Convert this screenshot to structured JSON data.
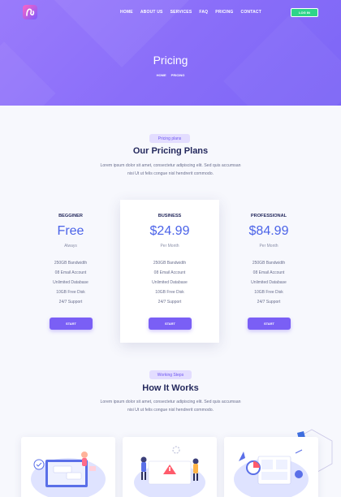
{
  "nav": {
    "items": [
      "HOME",
      "ABOUT US",
      "SERVICES",
      "FAQ",
      "PRICING",
      "CONTACT"
    ],
    "login_label": "LOG IN"
  },
  "hero": {
    "title": "Pricing",
    "breadcrumb": [
      "HOME",
      "PRICING"
    ]
  },
  "pricing": {
    "tag": "Pricing plans",
    "title": "Our Pricing Plans",
    "desc_line1": "Lorem ipsum dolor sit amet, consectetur adipiscing elit. Sed quis accumsan",
    "desc_line2": "nisi Ut ut felis congue nisl hendrerit commodo.",
    "plans": [
      {
        "name": "BEGGINER",
        "price": "Free",
        "period": "Always",
        "features": [
          "250GB Bandwidth",
          "08 Email Account",
          "Unlimited Database",
          "10GB Free Disk",
          "24/7 Support"
        ],
        "button": "START"
      },
      {
        "name": "BUSINESS",
        "price": "$24.99",
        "period": "Per Month",
        "features": [
          "250GB Bandwidth",
          "08 Email Account",
          "Unlimited Database",
          "10GB Free Disk",
          "24/7 Support"
        ],
        "button": "START"
      },
      {
        "name": "PROFESSIONAL",
        "price": "$84.99",
        "period": "Per Month",
        "features": [
          "250GB Bandwidth",
          "08 Email Account",
          "Unlimited Database",
          "10GB Free Disk",
          "24/7 Support"
        ],
        "button": "START"
      }
    ]
  },
  "steps": {
    "tag": "Working Steps",
    "title": "How It Works",
    "desc_line1": "Lorem ipsum dolor sit amet, consectetur adipiscing elit. Sed quis accumsan",
    "desc_line2": "nisi Ut ut felis congue nisl hendrerit commodo."
  },
  "colors": {
    "accent": "#7a5ff5",
    "price": "#4b63e8",
    "login": "#2fd58a",
    "hero_start": "#9a7bfb",
    "hero_end": "#7c66f6"
  }
}
